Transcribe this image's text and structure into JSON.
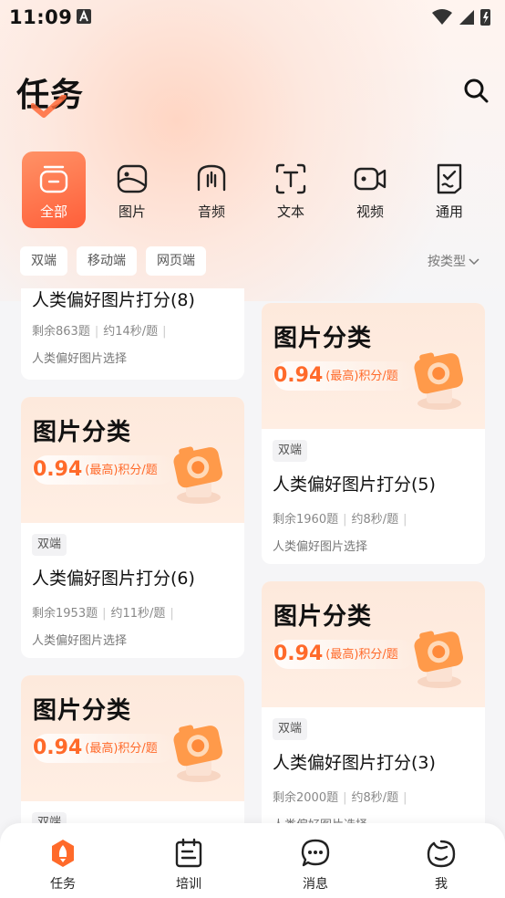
{
  "status_bar": {
    "time": "11:09"
  },
  "header": {
    "title": "任务"
  },
  "categories": [
    {
      "label": "全部",
      "icon": "all-icon"
    },
    {
      "label": "图片",
      "icon": "image-icon"
    },
    {
      "label": "音频",
      "icon": "audio-icon"
    },
    {
      "label": "文本",
      "icon": "text-icon"
    },
    {
      "label": "视频",
      "icon": "video-icon"
    },
    {
      "label": "通用",
      "icon": "general-icon"
    }
  ],
  "filters": {
    "chips": [
      "双端",
      "移动端",
      "网页端"
    ],
    "sort_label": "按类型"
  },
  "cards": [
    {
      "title": "人类偏好图片打分(8)",
      "remaining": "剩余863题",
      "time": "约14秒/题",
      "subtitle": "人类偏好图片选择"
    },
    {
      "banner_title": "图片分类",
      "rate_value": "0.94",
      "rate_suffix": "(最高)积分/题",
      "badge": "双端",
      "title": "人类偏好图片打分(5)",
      "remaining": "剩余1960题",
      "time": "约8秒/题",
      "subtitle": "人类偏好图片选择"
    },
    {
      "banner_title": "图片分类",
      "rate_value": "0.94",
      "rate_suffix": "(最高)积分/题",
      "badge": "双端",
      "title": "人类偏好图片打分(6)",
      "remaining": "剩余1953题",
      "time": "约11秒/题",
      "subtitle": "人类偏好图片选择"
    },
    {
      "banner_title": "图片分类",
      "rate_value": "0.94",
      "rate_suffix": "(最高)积分/题",
      "badge": "双端",
      "title": "人类偏好图片打分(3)",
      "remaining": "剩余2000题",
      "time": "约8秒/题",
      "subtitle": "人类偏好图片选择"
    },
    {
      "banner_title": "图片分类",
      "rate_value": "0.94",
      "rate_suffix": "(最高)积分/题",
      "badge": "双端"
    }
  ],
  "tabbar": [
    {
      "label": "任务",
      "icon": "task-rocket-icon"
    },
    {
      "label": "培训",
      "icon": "training-icon"
    },
    {
      "label": "消息",
      "icon": "message-icon"
    },
    {
      "label": "我",
      "icon": "profile-icon"
    }
  ],
  "colors": {
    "accent": "#ff6a2a",
    "active_tab_bg": "#ff7548",
    "banner_bg": "#fde9dc"
  }
}
